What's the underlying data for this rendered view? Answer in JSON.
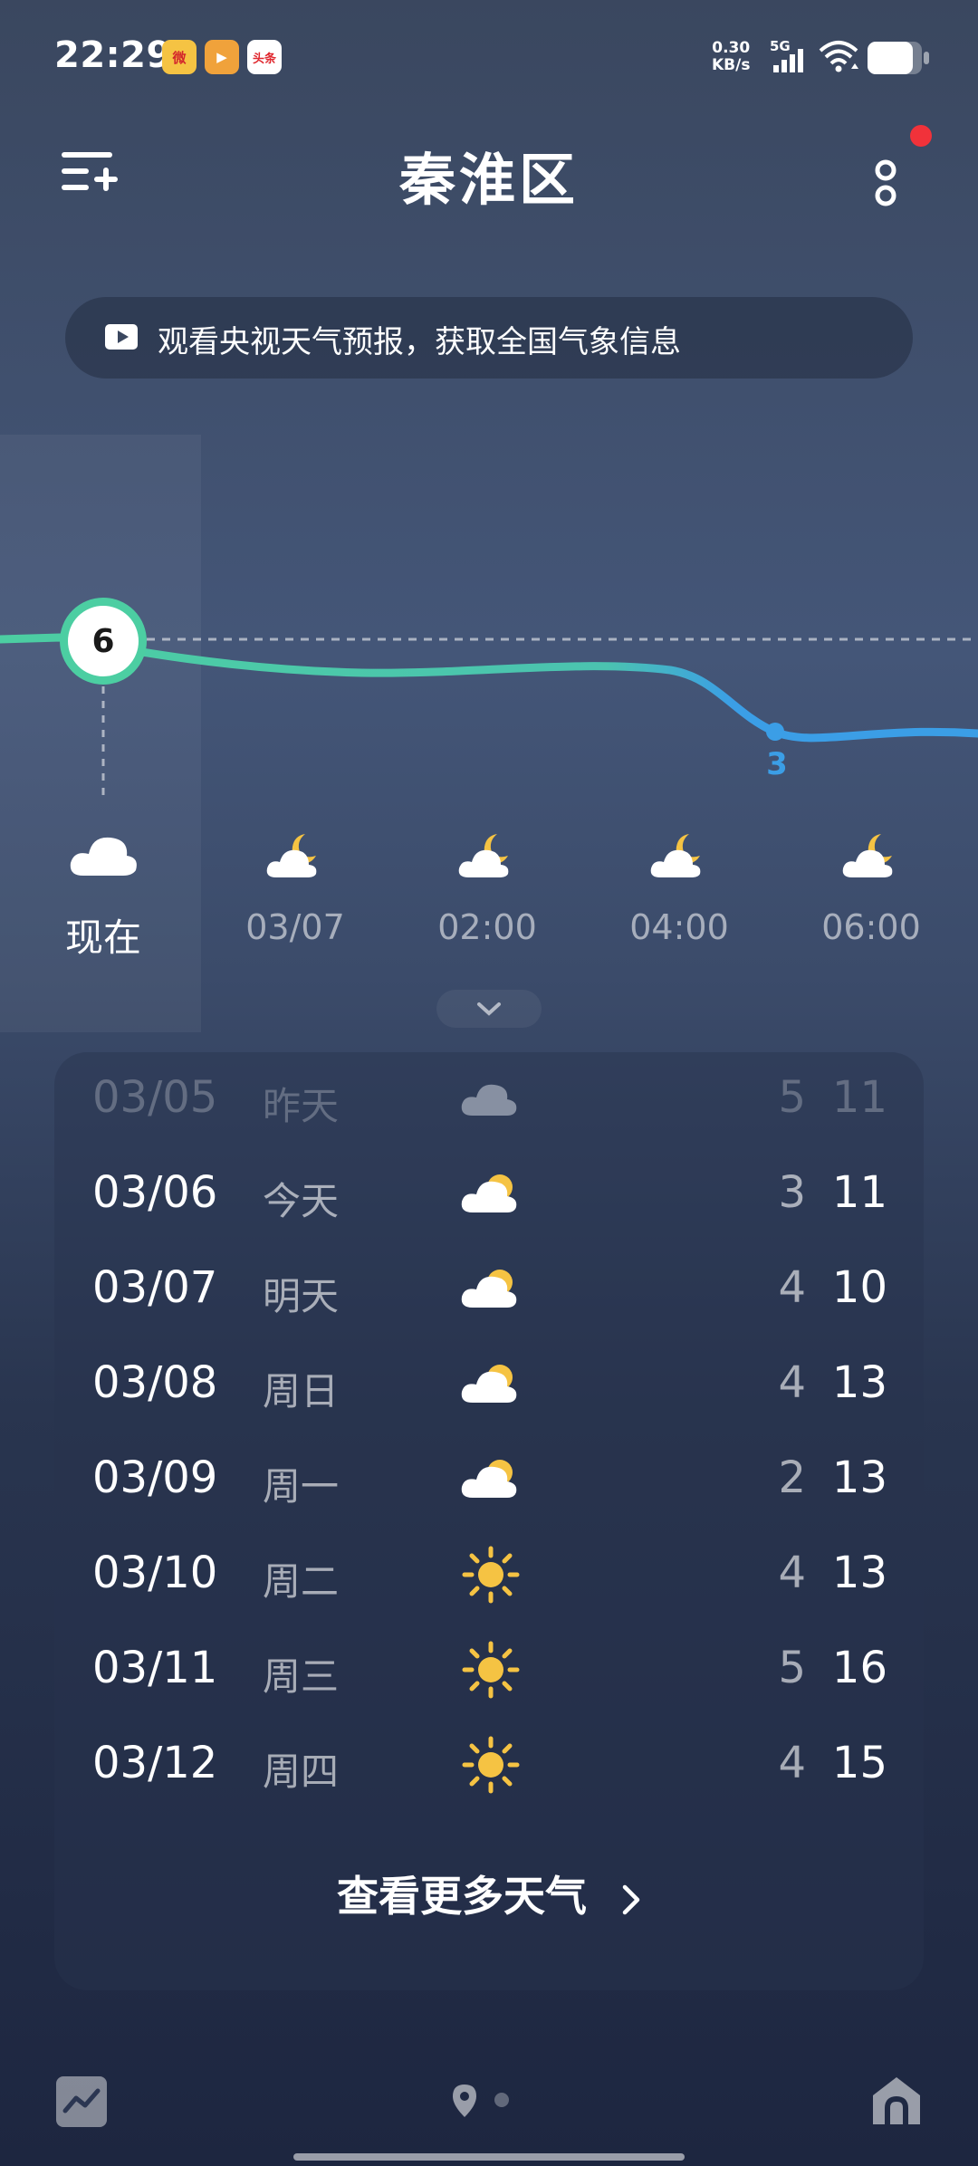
{
  "status_bar": {
    "time": "22:29",
    "notifications": [
      {
        "icon": "weibo-icon",
        "text": "微"
      },
      {
        "icon": "video-app-icon",
        "text": "▶"
      },
      {
        "icon": "toutiao-icon",
        "text": "头条"
      }
    ],
    "net_speed_value": "0.30",
    "net_speed_unit": "KB/s",
    "network_type": "5G",
    "wifi_icon": "wifi-icon",
    "battery_icon": "battery-icon"
  },
  "header": {
    "title": "秦淮区",
    "menu_icon": "menu-add-icon",
    "more_icon": "more-vertical-icon",
    "notification_dot_color": "#f1323a"
  },
  "banner": {
    "icon": "video-play-icon",
    "text": "观看央视天气预报，获取全国气象信息"
  },
  "hourly": {
    "current_temp": "6",
    "min_temp_label": "3",
    "line_colors": {
      "warm": "#4ccea2",
      "cool": "#3b9ee6"
    },
    "items": [
      {
        "label": "现在",
        "icon": "cloudy-icon"
      },
      {
        "label": "03/07",
        "icon": "partly-cloudy-night-icon"
      },
      {
        "label": "02:00",
        "icon": "partly-cloudy-night-icon"
      },
      {
        "label": "04:00",
        "icon": "partly-cloudy-night-icon"
      },
      {
        "label": "06:00",
        "icon": "partly-cloudy-night-icon"
      }
    ]
  },
  "expand_icon": "chevron-down-icon",
  "daily": {
    "rows": [
      {
        "date": "03/05",
        "weekday": "昨天",
        "icon": "cloudy-icon",
        "low": "5",
        "high": "11"
      },
      {
        "date": "03/06",
        "weekday": "今天",
        "icon": "partly-cloudy-icon",
        "low": "3",
        "high": "11"
      },
      {
        "date": "03/07",
        "weekday": "明天",
        "icon": "partly-cloudy-icon",
        "low": "4",
        "high": "10"
      },
      {
        "date": "03/08",
        "weekday": "周日",
        "icon": "partly-cloudy-icon",
        "low": "4",
        "high": "13"
      },
      {
        "date": "03/09",
        "weekday": "周一",
        "icon": "partly-cloudy-icon",
        "low": "2",
        "high": "13"
      },
      {
        "date": "03/10",
        "weekday": "周二",
        "icon": "sunny-icon",
        "low": "4",
        "high": "13"
      },
      {
        "date": "03/11",
        "weekday": "周三",
        "icon": "sunny-icon",
        "low": "5",
        "high": "16"
      },
      {
        "date": "03/12",
        "weekday": "周四",
        "icon": "sunny-icon",
        "low": "4",
        "high": "15"
      }
    ],
    "more_label": "查看更多天气"
  },
  "bottom_bar": {
    "trend_icon": "trend-chart-icon",
    "location_icon": "location-pin-icon",
    "home_icon": "home-icon"
  }
}
